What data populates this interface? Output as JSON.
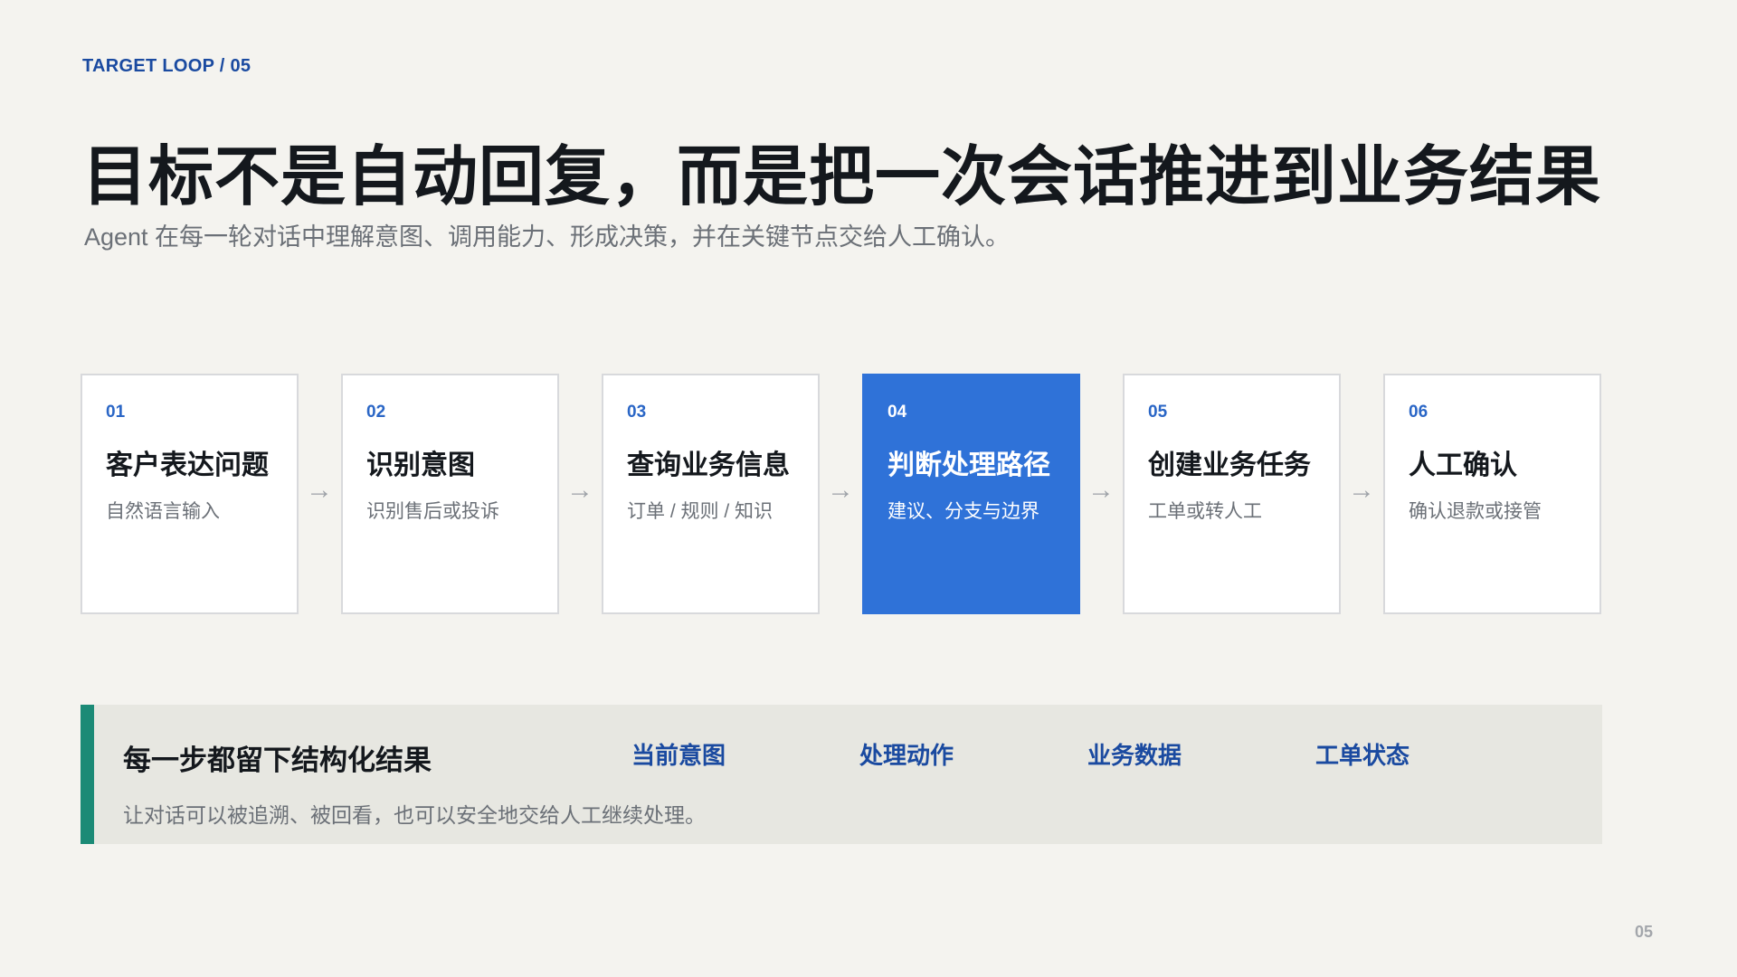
{
  "header": {
    "eyebrow": "TARGET LOOP / 05",
    "title": "目标不是自动回复，而是把一次会话推进到业务结果",
    "subtitle": "Agent 在每一轮对话中理解意图、调用能力、形成决策，并在关键节点交给人工确认。"
  },
  "flow": {
    "arrow_glyph": "→",
    "steps": [
      {
        "num": "01",
        "title": "客户表达问题",
        "desc": "自然语言输入",
        "active": false
      },
      {
        "num": "02",
        "title": "识别意图",
        "desc": "识别售后或投诉",
        "active": false
      },
      {
        "num": "03",
        "title": "查询业务信息",
        "desc": "订单 / 规则 / 知识",
        "active": false
      },
      {
        "num": "04",
        "title": "判断处理路径",
        "desc": "建议、分支与边界",
        "active": true
      },
      {
        "num": "05",
        "title": "创建业务任务",
        "desc": "工单或转人工",
        "active": false
      },
      {
        "num": "06",
        "title": "人工确认",
        "desc": "确认退款或接管",
        "active": false
      }
    ]
  },
  "summary": {
    "title": "每一步都留下结构化结果",
    "desc": "让对话可以被追溯、被回看，也可以安全地交给人工继续处理。",
    "tags": [
      "当前意图",
      "处理动作",
      "业务数据",
      "工单状态"
    ]
  },
  "colors": {
    "background": "#f4f3ef",
    "accent_blue": "#2f72d8",
    "summary_bar": "#1b8a76",
    "heading_blue": "#1a4aa0"
  },
  "footer": {
    "page_number": "05"
  }
}
